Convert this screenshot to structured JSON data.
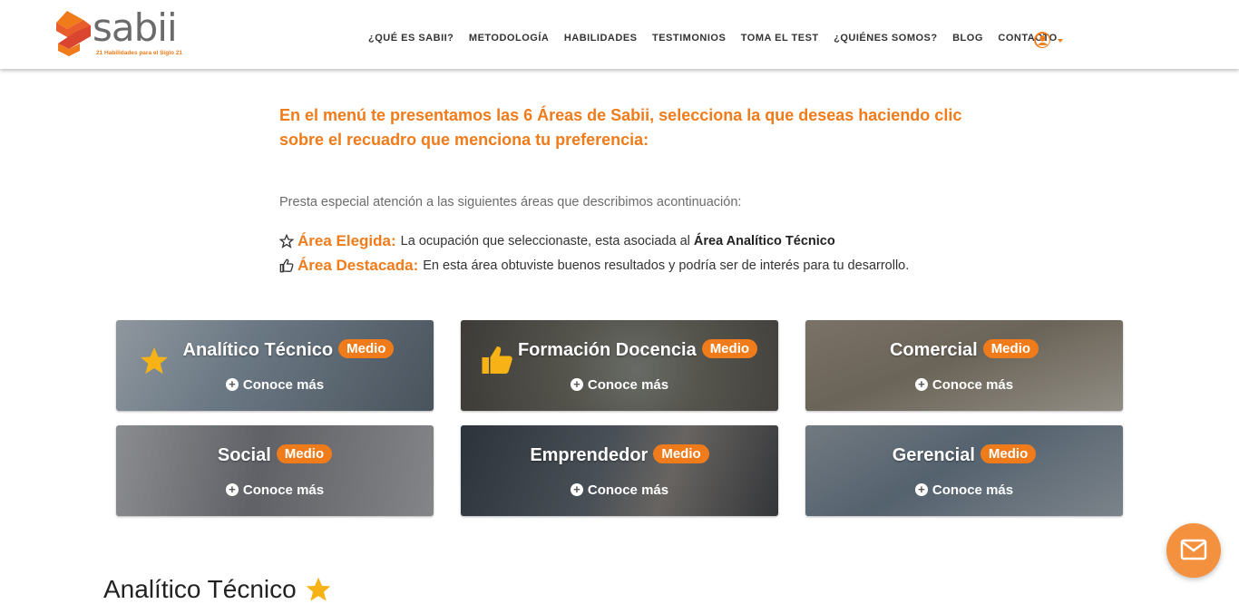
{
  "brand": {
    "name": "sabii",
    "tagline": "21 Habilidades para el Siglo 21",
    "accent": "#f07b1a"
  },
  "nav": {
    "items": [
      "¿QUÉ ES SABII?",
      "METODOLOGÍA",
      "HABILIDADES",
      "TESTIMONIOS",
      "TOMA EL TEST",
      "¿QUIÉNES SOMOS?",
      "BLOG",
      "CONTACTO"
    ],
    "user_icon": "user-circle-icon"
  },
  "intro": "En el menú te presentamos las 6 Áreas de Sabii, selecciona la que deseas haciendo clic sobre el recuadro que menciona tu preferencia:",
  "note": "Presta especial atención a las siguientes áreas que describimos acontinuación:",
  "legend": {
    "chosen_label": "Área Elegida:",
    "chosen_text": "La ocupación que seleccionaste, esta asociada al",
    "chosen_area": "Área Analítico Técnico",
    "highlight_label": "Área Destacada:",
    "highlight_text": "En esta área obtuviste buenos resultados y podría ser de interés para tu desarrollo."
  },
  "cards": [
    {
      "title": "Analítico Técnico",
      "level": "Medio",
      "more": "Conoce más",
      "icon": "star-icon"
    },
    {
      "title": "Formación Docencia",
      "level": "Medio",
      "more": "Conoce más",
      "icon": "thumbs-up-icon"
    },
    {
      "title": "Comercial",
      "level": "Medio",
      "more": "Conoce más"
    },
    {
      "title": "Social",
      "level": "Medio",
      "more": "Conoce más"
    },
    {
      "title": "Emprendedor",
      "level": "Medio",
      "more": "Conoce más"
    },
    {
      "title": "Gerencial",
      "level": "Medio",
      "more": "Conoce más"
    }
  ],
  "section_title": "Analítico Técnico",
  "chat_icon": "mail-icon"
}
